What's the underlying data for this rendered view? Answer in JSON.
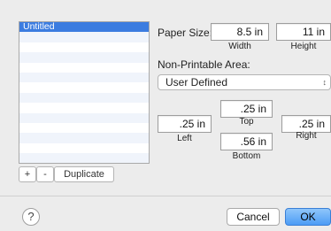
{
  "size_list": {
    "items": [
      "Untitled"
    ],
    "selected_index": 0,
    "blank_rows": 13
  },
  "list_controls": {
    "add_label": "+",
    "remove_label": "-",
    "duplicate_label": "Duplicate"
  },
  "paper_size": {
    "label": "Paper Size:",
    "width_value": "8.5 in",
    "width_label": "Width",
    "height_value": "11 in",
    "height_label": "Height"
  },
  "non_printable": {
    "label": "Non-Printable Area:",
    "selected": "User Defined",
    "top_value": ".25 in",
    "top_label": "Top",
    "left_value": ".25 in",
    "left_label": "Left",
    "right_value": ".25 in",
    "right_label": "Right",
    "bottom_value": ".56 in",
    "bottom_label": "Bottom"
  },
  "footer": {
    "help_label": "?",
    "cancel_label": "Cancel",
    "ok_label": "OK"
  },
  "colors": {
    "selection": "#3b7ce0",
    "primary_button": "#4c9cf5"
  },
  "icons": {
    "popup_arrows": "updown-arrows-icon",
    "help": "help-icon"
  }
}
